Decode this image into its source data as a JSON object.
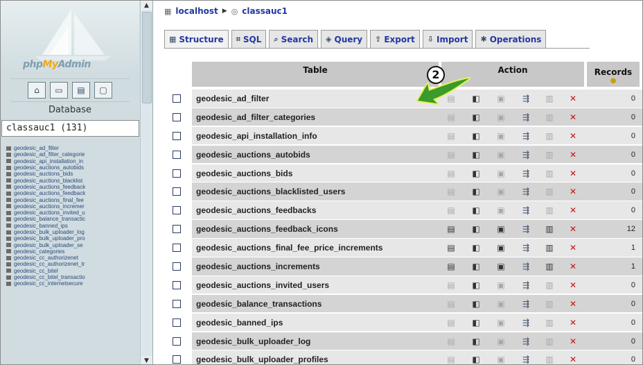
{
  "app": {
    "logo": {
      "prefix": "php",
      "my": "My",
      "suffix": "Admin"
    }
  },
  "left_panel": {
    "database_label": "Database",
    "selected_database": "classauc1 (131)",
    "tables": [
      "geodesic_ad_filter",
      "geodesic_ad_filter_categorie",
      "geodesic_api_installation_in",
      "geodesic_auctions_autobids",
      "geodesic_auctions_bids",
      "geodesic_auctions_blacklist",
      "geodesic_auctions_feedback",
      "geodesic_auctions_feedback",
      "geodesic_auctions_final_fee",
      "geodesic_auctions_incremer",
      "geodesic_auctions_invited_u",
      "geodesic_balance_transactic",
      "geodesic_banned_ips",
      "geodesic_bulk_uploader_log",
      "geodesic_bulk_uploader_pro",
      "geodesic_bulk_uploader_se",
      "geodesic_categories",
      "geodesic_cc_authorizenet",
      "geodesic_cc_authorizenet_tr",
      "geodesic_cc_bitel",
      "geodesic_cc_bitel_transactio",
      "geodesic_cc_internetsecure"
    ]
  },
  "breadcrumb": {
    "server": "localhost",
    "database": "classauc1"
  },
  "tabs": [
    {
      "label": "Structure",
      "icon": "structure-icon"
    },
    {
      "label": "SQL",
      "icon": "sql-icon"
    },
    {
      "label": "Search",
      "icon": "search-icon"
    },
    {
      "label": "Query",
      "icon": "query-icon"
    },
    {
      "label": "Export",
      "icon": "export-icon"
    },
    {
      "label": "Import",
      "icon": "import-icon"
    },
    {
      "label": "Operations",
      "icon": "operations-icon"
    }
  ],
  "table_headers": {
    "table": "Table",
    "action": "Action",
    "records": "Records"
  },
  "callout": {
    "number": "2",
    "color": "#3a9a2a"
  },
  "rows": [
    {
      "name": "geodesic_ad_filter",
      "records": "0",
      "has_data": false
    },
    {
      "name": "geodesic_ad_filter_categories",
      "records": "0",
      "has_data": false
    },
    {
      "name": "geodesic_api_installation_info",
      "records": "0",
      "has_data": false
    },
    {
      "name": "geodesic_auctions_autobids",
      "records": "0",
      "has_data": false
    },
    {
      "name": "geodesic_auctions_bids",
      "records": "0",
      "has_data": false
    },
    {
      "name": "geodesic_auctions_blacklisted_users",
      "records": "0",
      "has_data": false
    },
    {
      "name": "geodesic_auctions_feedbacks",
      "records": "0",
      "has_data": false
    },
    {
      "name": "geodesic_auctions_feedback_icons",
      "records": "12",
      "has_data": true
    },
    {
      "name": "geodesic_auctions_final_fee_price_increments",
      "records": "1",
      "has_data": true
    },
    {
      "name": "geodesic_auctions_increments",
      "records": "1",
      "has_data": true
    },
    {
      "name": "geodesic_auctions_invited_users",
      "records": "0",
      "has_data": false
    },
    {
      "name": "geodesic_balance_transactions",
      "records": "0",
      "has_data": false
    },
    {
      "name": "geodesic_banned_ips",
      "records": "0",
      "has_data": false
    },
    {
      "name": "geodesic_bulk_uploader_log",
      "records": "0",
      "has_data": false
    },
    {
      "name": "geodesic_bulk_uploader_profiles",
      "records": "0",
      "has_data": false
    }
  ]
}
